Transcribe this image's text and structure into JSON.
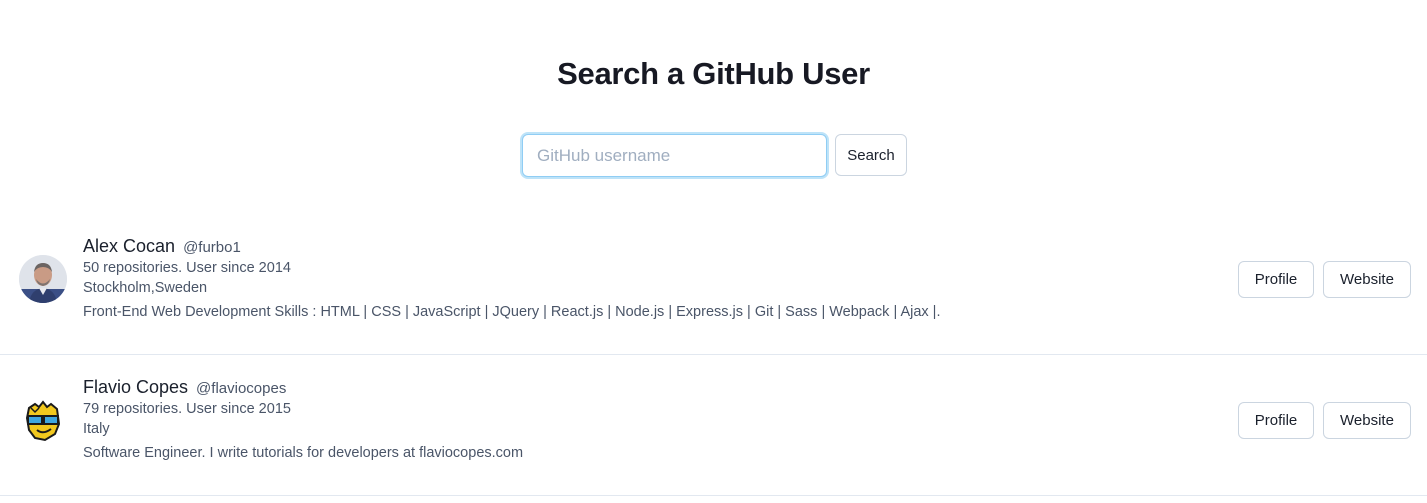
{
  "header": {
    "title": "Search a GitHub User"
  },
  "search": {
    "placeholder": "GitHub username",
    "value": "",
    "button_label": "Search"
  },
  "users": [
    {
      "name": "Alex Cocan",
      "handle": "@furbo1",
      "stats": "50 repositories. User since 2014",
      "location": "Stockholm,Sweden",
      "bio": "Front-End Web Development Skills : HTML | CSS | JavaScript | JQuery | React.js | Node.js | Express.js | Git | Sass | Webpack | Ajax |.",
      "profile_label": "Profile",
      "website_label": "Website"
    },
    {
      "name": "Flavio Copes",
      "handle": "@flaviocopes",
      "stats": "79 repositories. User since 2015",
      "location": "Italy",
      "bio": "Software Engineer. I write tutorials for developers at flaviocopes.com",
      "profile_label": "Profile",
      "website_label": "Website"
    }
  ]
}
